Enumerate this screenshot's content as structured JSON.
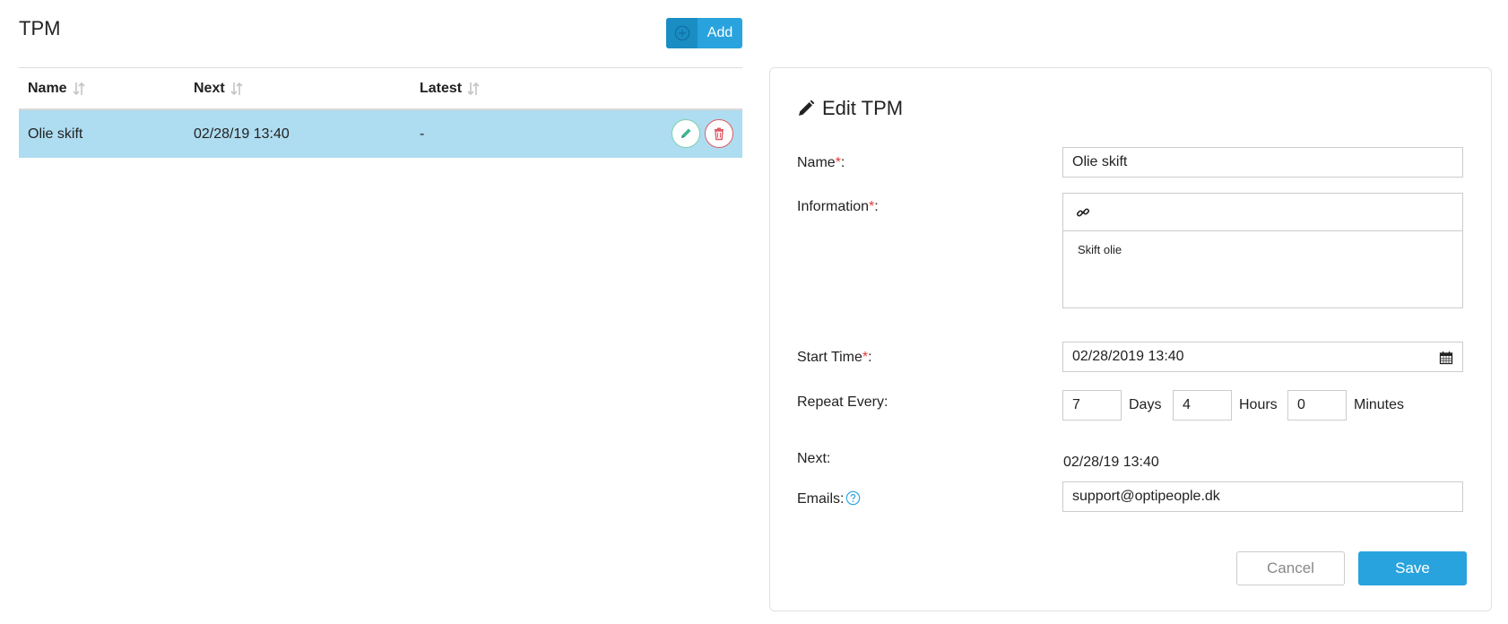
{
  "page": {
    "title": "TPM"
  },
  "toolbar": {
    "add_label": "Add"
  },
  "table": {
    "headers": {
      "name": "Name",
      "next": "Next",
      "latest": "Latest"
    },
    "rows": [
      {
        "name": "Olie skift",
        "next": "02/28/19 13:40",
        "latest": "-"
      }
    ]
  },
  "form": {
    "title": "Edit TPM",
    "required_mark": "*",
    "name": {
      "label": "Name",
      "value": "Olie skift"
    },
    "information": {
      "label": "Information",
      "value": "Skift olie"
    },
    "start_time": {
      "label": "Start Time",
      "value": "02/28/2019 13:40"
    },
    "repeat": {
      "label": "Repeat Every:",
      "days": "7",
      "days_label": "Days",
      "hours": "4",
      "hours_label": "Hours",
      "minutes": "0",
      "minutes_label": "Minutes"
    },
    "next": {
      "label": "Next:",
      "value": "02/28/19 13:40"
    },
    "emails": {
      "label": "Emails:",
      "value": "support@optipeople.dk"
    },
    "cancel_label": "Cancel",
    "save_label": "Save"
  },
  "colors": {
    "accent": "#29a3dd",
    "row_highlight": "#aedcf0",
    "required": "#e53935",
    "delete": "#e05b67",
    "edit": "#3bb78f"
  },
  "icons": [
    "plus-circle-icon",
    "sort-icon",
    "pencil-icon",
    "trash-icon",
    "link-icon",
    "calendar-icon",
    "help-icon"
  ]
}
